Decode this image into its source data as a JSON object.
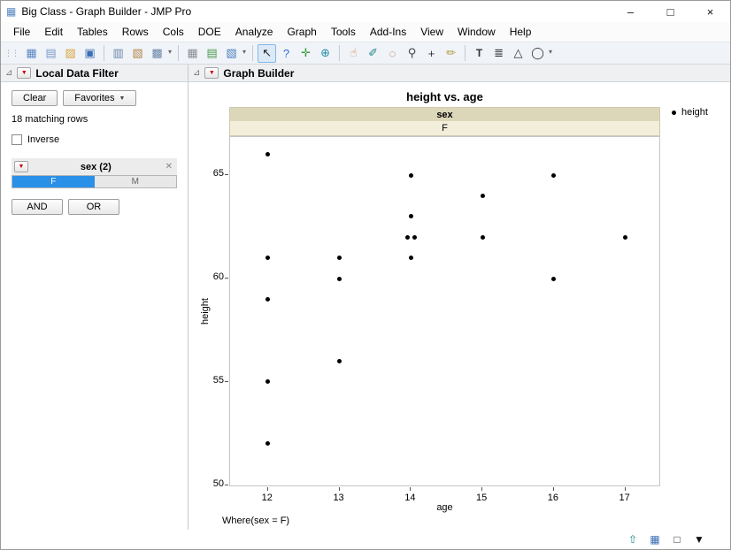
{
  "window": {
    "title": "Big Class - Graph Builder - JMP Pro"
  },
  "icons": {
    "app": "▦",
    "minimize": "–",
    "maximize": "□",
    "close": "×",
    "disclosure": "⊿",
    "red_triangle": "▼",
    "dropdown_arrow": "▼",
    "close_x": "✕",
    "chevron_down": "▾",
    "grip": "⋮⋮"
  },
  "menu": {
    "items": [
      "File",
      "Edit",
      "Tables",
      "Rows",
      "Cols",
      "DOE",
      "Analyze",
      "Graph",
      "Tools",
      "Add-Ins",
      "View",
      "Window",
      "Help"
    ]
  },
  "toolbar": {
    "groups": [
      {
        "icons": [
          {
            "name": "new-data-table-icon",
            "glyph": "▦",
            "color": "#5b8ac5"
          },
          {
            "name": "new-journal-icon",
            "glyph": "▤",
            "color": "#7a9cc9"
          },
          {
            "name": "open-icon",
            "glyph": "▨",
            "color": "#d9a33c"
          },
          {
            "name": "save-icon",
            "glyph": "▣",
            "color": "#3b6fb5"
          }
        ]
      },
      {
        "icons": [
          {
            "name": "copy-icon",
            "glyph": "▥",
            "color": "#6b87a8"
          },
          {
            "name": "paste-icon",
            "glyph": "▧",
            "color": "#b08648"
          },
          {
            "name": "copy-table-icon",
            "glyph": "▩",
            "color": "#6b87a8"
          }
        ],
        "chevron": true
      },
      {
        "icons": [
          {
            "name": "layout-icon",
            "glyph": "▦",
            "color": "#8a8f94"
          },
          {
            "name": "journal-add-icon",
            "glyph": "▤",
            "color": "#4a9c4a"
          },
          {
            "name": "script-window-icon",
            "glyph": "▧",
            "color": "#4a7fbf"
          }
        ],
        "chevron": true
      },
      {
        "icons": [
          {
            "name": "arrow-tool-icon",
            "glyph": "↖",
            "color": "#222222",
            "selected": true
          },
          {
            "name": "help-tool-icon",
            "glyph": "?",
            "color": "#2a6fd4"
          },
          {
            "name": "crosshair-tool-icon",
            "glyph": "✛",
            "color": "#3a9c3a"
          },
          {
            "name": "globe-tool-icon",
            "glyph": "⊕",
            "color": "#2a8fa8"
          }
        ]
      },
      {
        "icons": [
          {
            "name": "grabber-tool-icon",
            "glyph": "☝",
            "color": "#c8873c"
          },
          {
            "name": "brush-tool-icon",
            "glyph": "✐",
            "color": "#1f8a8a"
          },
          {
            "name": "lasso-tool-icon",
            "glyph": "◌",
            "color": "#a85a2a"
          },
          {
            "name": "magnifier-tool-icon",
            "glyph": "⚲",
            "color": "#444444"
          },
          {
            "name": "plus-tool-icon",
            "glyph": "+",
            "color": "#333333"
          },
          {
            "name": "annotate-tool-icon",
            "glyph": "✏",
            "color": "#b59a3a"
          }
        ]
      },
      {
        "icons": [
          {
            "name": "text-tool-icon",
            "glyph": "T",
            "color": "#333333",
            "boxed": true
          },
          {
            "name": "lines-tool-icon",
            "glyph": "≣",
            "color": "#333333"
          },
          {
            "name": "polygon-tool-icon",
            "glyph": "△",
            "color": "#333333"
          },
          {
            "name": "oval-tool-icon",
            "glyph": "◯",
            "color": "#333333"
          }
        ],
        "chevron": true
      }
    ]
  },
  "filter": {
    "title": "Local Data Filter",
    "clear_label": "Clear",
    "favorites_label": "Favorites",
    "matching_rows": "18 matching rows",
    "inverse_label": "Inverse",
    "group": {
      "title": "sex (2)",
      "levels": [
        {
          "label": "F",
          "selected": true
        },
        {
          "label": "M",
          "selected": false
        }
      ]
    },
    "and_label": "AND",
    "or_label": "OR",
    "selected_color": "#2b90e8"
  },
  "graph": {
    "title": "Graph Builder"
  },
  "chart_data": {
    "type": "scatter",
    "title": "height vs. age",
    "xlabel": "age",
    "ylabel": "height",
    "group_header": {
      "label": "sex",
      "value": "F"
    },
    "legend": [
      "height"
    ],
    "where": "Where(sex = F)",
    "xlim": [
      11.47,
      17.5
    ],
    "ylim": [
      49.9,
      66.85
    ],
    "xticks": [
      12,
      13,
      14,
      15,
      16,
      17
    ],
    "yticks": [
      50,
      55,
      60,
      65
    ],
    "grid": false,
    "marker_color": "#000000",
    "points": [
      {
        "x": 12,
        "y": 66
      },
      {
        "x": 12,
        "y": 61
      },
      {
        "x": 12,
        "y": 59
      },
      {
        "x": 12,
        "y": 55
      },
      {
        "x": 12,
        "y": 52
      },
      {
        "x": 13,
        "y": 61
      },
      {
        "x": 13,
        "y": 60
      },
      {
        "x": 13,
        "y": 56
      },
      {
        "x": 14,
        "y": 65
      },
      {
        "x": 14,
        "y": 63
      },
      {
        "x": 14,
        "y": 62
      },
      {
        "x": 14,
        "y": 62
      },
      {
        "x": 14,
        "y": 61
      },
      {
        "x": 15,
        "y": 64
      },
      {
        "x": 15,
        "y": 62
      },
      {
        "x": 16,
        "y": 65
      },
      {
        "x": 16,
        "y": 60
      },
      {
        "x": 17,
        "y": 62
      }
    ]
  },
  "statusbar": {
    "icons": [
      {
        "name": "up-arrow-icon",
        "glyph": "⇧",
        "color": "#1f8a8a"
      },
      {
        "name": "data-table-status-icon",
        "glyph": "▦",
        "color": "#3b6fb5"
      },
      {
        "name": "empty-box-icon",
        "glyph": "□",
        "color": "#333333"
      },
      {
        "name": "status-dropdown-icon",
        "glyph": "▼",
        "color": "#111111"
      }
    ]
  }
}
